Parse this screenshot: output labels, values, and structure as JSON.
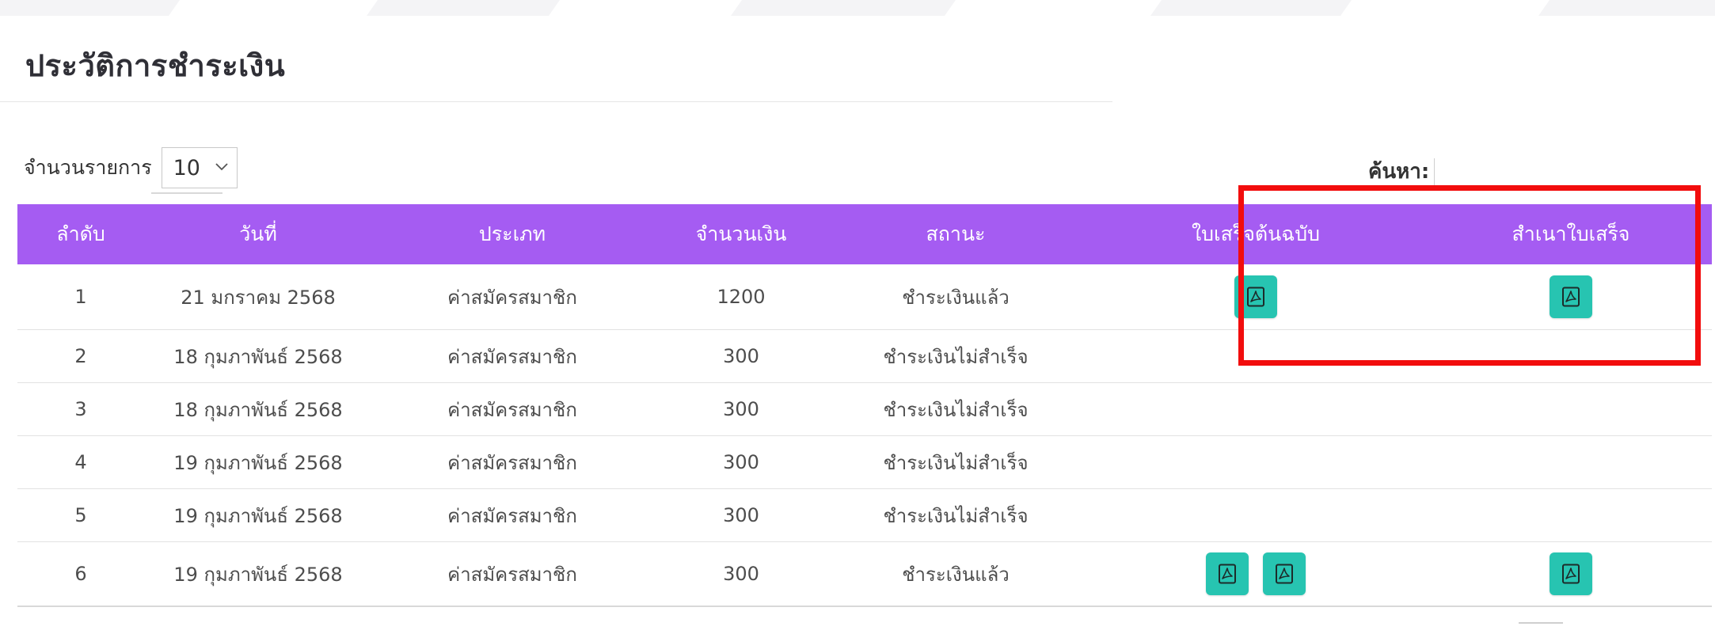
{
  "page": {
    "title": "ประวัติการชำระเงิน"
  },
  "controls": {
    "length_label": "จำนวนรายการ",
    "length_value": "10",
    "search_label": "ค้นหา:"
  },
  "table": {
    "headers": [
      "ลำดับ",
      "วันที่",
      "ประเภท",
      "จำนวนเงิน",
      "สถานะ",
      "ใบเสร็จต้นฉบับ",
      "สำเนาใบเสร็จ"
    ],
    "rows": [
      {
        "no": "1",
        "date": "21 มกราคม 2568",
        "type": "ค่าสมัครสมาชิก",
        "amount": "1200",
        "status": "ชำระเงินแล้ว",
        "original_receipts": 1,
        "copy_receipts": 1
      },
      {
        "no": "2",
        "date": "18 กุมภาพันธ์ 2568",
        "type": "ค่าสมัครสมาชิก",
        "amount": "300",
        "status": "ชำระเงินไม่สำเร็จ",
        "original_receipts": 0,
        "copy_receipts": 0
      },
      {
        "no": "3",
        "date": "18 กุมภาพันธ์ 2568",
        "type": "ค่าสมัครสมาชิก",
        "amount": "300",
        "status": "ชำระเงินไม่สำเร็จ",
        "original_receipts": 0,
        "copy_receipts": 0
      },
      {
        "no": "4",
        "date": "19 กุมภาพันธ์ 2568",
        "type": "ค่าสมัครสมาชิก",
        "amount": "300",
        "status": "ชำระเงินไม่สำเร็จ",
        "original_receipts": 0,
        "copy_receipts": 0
      },
      {
        "no": "5",
        "date": "19 กุมภาพันธ์ 2568",
        "type": "ค่าสมัครสมาชิก",
        "amount": "300",
        "status": "ชำระเงินไม่สำเร็จ",
        "original_receipts": 0,
        "copy_receipts": 0
      },
      {
        "no": "6",
        "date": "19 กุมภาพันธ์ 2568",
        "type": "ค่าสมัครสมาชิก",
        "amount": "300",
        "status": "ชำระเงินแล้ว",
        "original_receipts": 2,
        "copy_receipts": 1
      }
    ]
  },
  "icons": {
    "receipt": "pdf-file-icon",
    "select_arrow": "chevron-down-icon"
  },
  "colors": {
    "header_bg": "#a55cf2",
    "pdf_button": "#27c4b1",
    "highlight": "#f20d0d"
  }
}
